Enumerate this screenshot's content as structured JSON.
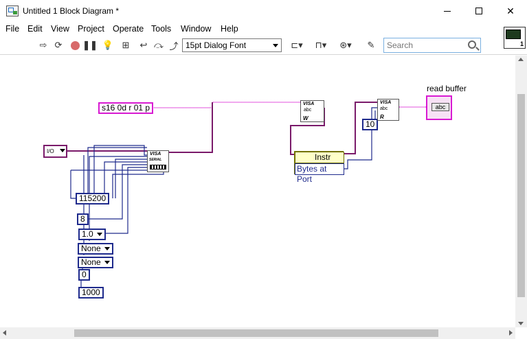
{
  "window": {
    "title": "Untitled 1 Block Diagram *",
    "minimize_label": "—",
    "maximize_label": "☐",
    "close_label": "✕"
  },
  "menu": [
    "File",
    "Edit",
    "View",
    "Project",
    "Operate",
    "Tools",
    "Window",
    "Help"
  ],
  "toolbar": {
    "font_select": "15pt Dialog Font",
    "search_placeholder": "Search",
    "vi_icon_number": "1"
  },
  "diagram": {
    "write_string": "s16 0d r 01 p",
    "resource_ring": "I/O",
    "baud_rate": "115200",
    "data_bits": "8",
    "stop_bits": "1.0",
    "parity": "None",
    "flow_control": "None",
    "termination_char": "0",
    "timeout": "1000",
    "read_count": "10",
    "property_class": "Instr",
    "property_name": "Bytes at Port",
    "indicator_label": "read buffer",
    "serial_node_label": "VISA",
    "serial_node_sub": "SERIAL",
    "write_node_label": "VISA",
    "write_node_sub": "W",
    "read_node_label": "VISA",
    "read_node_sub": "R",
    "indicator_text": "abc"
  },
  "colors": {
    "string_wire": "#d81ad2",
    "visa_wire": "#7a1a6a",
    "numeric_wire": "#1e2a8c"
  }
}
